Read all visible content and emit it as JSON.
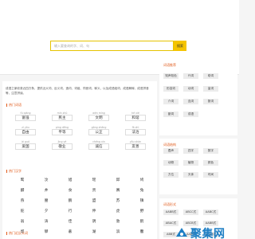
{
  "search": {
    "placeholder": "输入要查询的字、词、句",
    "button": "搜索"
  },
  "intro": "成语之家收录近四万条，提供近义词、反义词、造词、词组、同音词、释义，以及成语组词、成语解释、成语拼音等，注意拼读。",
  "hot_pinyin_title": "热门词语",
  "hot_pinyin": [
    {
      "py": "fù qiáng",
      "w": "富强"
    },
    {
      "py": "mín zhǔ",
      "w": "民主"
    },
    {
      "py": "wén míng",
      "w": "文明"
    },
    {
      "py": "hé xié",
      "w": "和谐"
    },
    {
      "py": "zì yóu",
      "w": "自由"
    },
    {
      "py": "píng děng",
      "w": "平等"
    },
    {
      "py": "gōng zhèng",
      "w": "公正"
    },
    {
      "py": "fǎ zhì",
      "w": "法治"
    },
    {
      "py": "ài guó",
      "w": "爱国"
    },
    {
      "py": "jìng yè",
      "w": "敬业"
    },
    {
      "py": "chéng xìn",
      "w": "诚信"
    },
    {
      "py": "yǒu shàn",
      "w": "友善"
    }
  ],
  "hot_chars_title": "热门汉字",
  "hot_chars": [
    "鹭",
    "汶",
    "旭",
    "瑶",
    "邱",
    "鸠",
    "麟",
    "井",
    "食",
    "贵",
    "赛",
    "兔",
    "燕",
    "腰",
    "鹏",
    "盟",
    "苏",
    "镇",
    "舵",
    "夕",
    "行",
    "伸",
    "虎",
    "野",
    "翁",
    "涛",
    "佳",
    "阴",
    "敦",
    "鹤",
    "郭",
    "攀",
    "蔽",
    "湖",
    "滨",
    "馨"
  ],
  "bottom_title": "热门近反义词",
  "side_recommend": {
    "title": "词语推荐",
    "tags": [
      "知声知色",
      "代词",
      "助词",
      "形容词",
      "动词",
      "量词",
      "介词",
      "连词",
      "数词",
      "副词",
      "成语"
    ]
  },
  "side_structure": {
    "title": "词语结构",
    "tags": [
      "叠声",
      "四字",
      "数字",
      "动物",
      "植物",
      "颜色",
      "方位",
      "天体",
      "时间"
    ]
  },
  "side_form": {
    "title": "词语形式",
    "tags": [
      "AABB式",
      "ABCC式",
      "AABC式",
      "ABAC式",
      "ABCB式",
      "AABB式",
      "ABB式",
      "AAB式",
      "ABAB式"
    ]
  },
  "watermark": "聚集网"
}
